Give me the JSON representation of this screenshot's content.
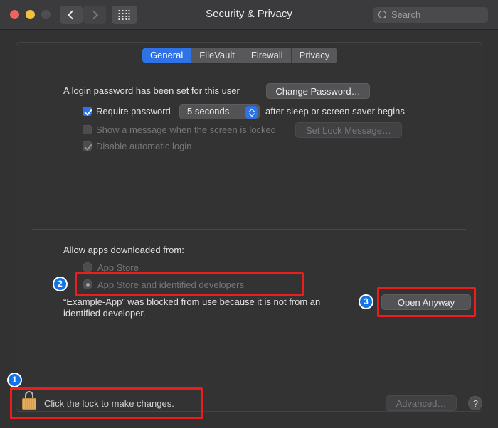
{
  "window": {
    "title": "Security & Privacy",
    "traffic_lights": [
      "close",
      "minimize",
      "zoom"
    ],
    "nav": {
      "back": "back-arrow",
      "forward": "forward-arrow",
      "grid": "show-all-preferences"
    },
    "search": {
      "placeholder": "Search",
      "value": "",
      "icon": "search-icon"
    }
  },
  "tabs": [
    {
      "label": "General",
      "selected": true
    },
    {
      "label": "FileVault",
      "selected": false
    },
    {
      "label": "Firewall",
      "selected": false
    },
    {
      "label": "Privacy",
      "selected": false
    }
  ],
  "general": {
    "login_password_text": "A login password has been set for this user",
    "change_password_button": "Change Password…",
    "require_password": {
      "label": "Require password",
      "checked": true,
      "delay_value": "5 seconds",
      "suffix": "after sleep or screen saver begins"
    },
    "show_message": {
      "label": "Show a message when the screen is locked",
      "checked": false,
      "disabled": true,
      "button": "Set Lock Message…"
    },
    "disable_auto_login": {
      "label": "Disable automatic login",
      "checked": true,
      "disabled": true
    }
  },
  "gatekeeper": {
    "heading": "Allow apps downloaded from:",
    "options": [
      {
        "label": "App Store",
        "selected": false,
        "disabled": true
      },
      {
        "label": "App Store and identified developers",
        "selected": true,
        "disabled": true
      }
    ],
    "blocked_message": "“Example-App” was blocked from use because it is not from an identified developer.",
    "open_anyway_button": "Open Anyway"
  },
  "footer": {
    "lock_label": "Click the lock to make changes.",
    "lock_icon": "closed-padlock-icon",
    "advanced_button": "Advanced…",
    "advanced_disabled": true,
    "help_button": "?"
  },
  "annotations": {
    "badges": [
      {
        "number": "1",
        "target": "lock-row"
      },
      {
        "number": "2",
        "target": "gatekeeper-option-identified-developers"
      },
      {
        "number": "3",
        "target": "open-anyway-button"
      }
    ],
    "highlight_color": "#ee1c1c",
    "badge_color": "#1273e6"
  }
}
